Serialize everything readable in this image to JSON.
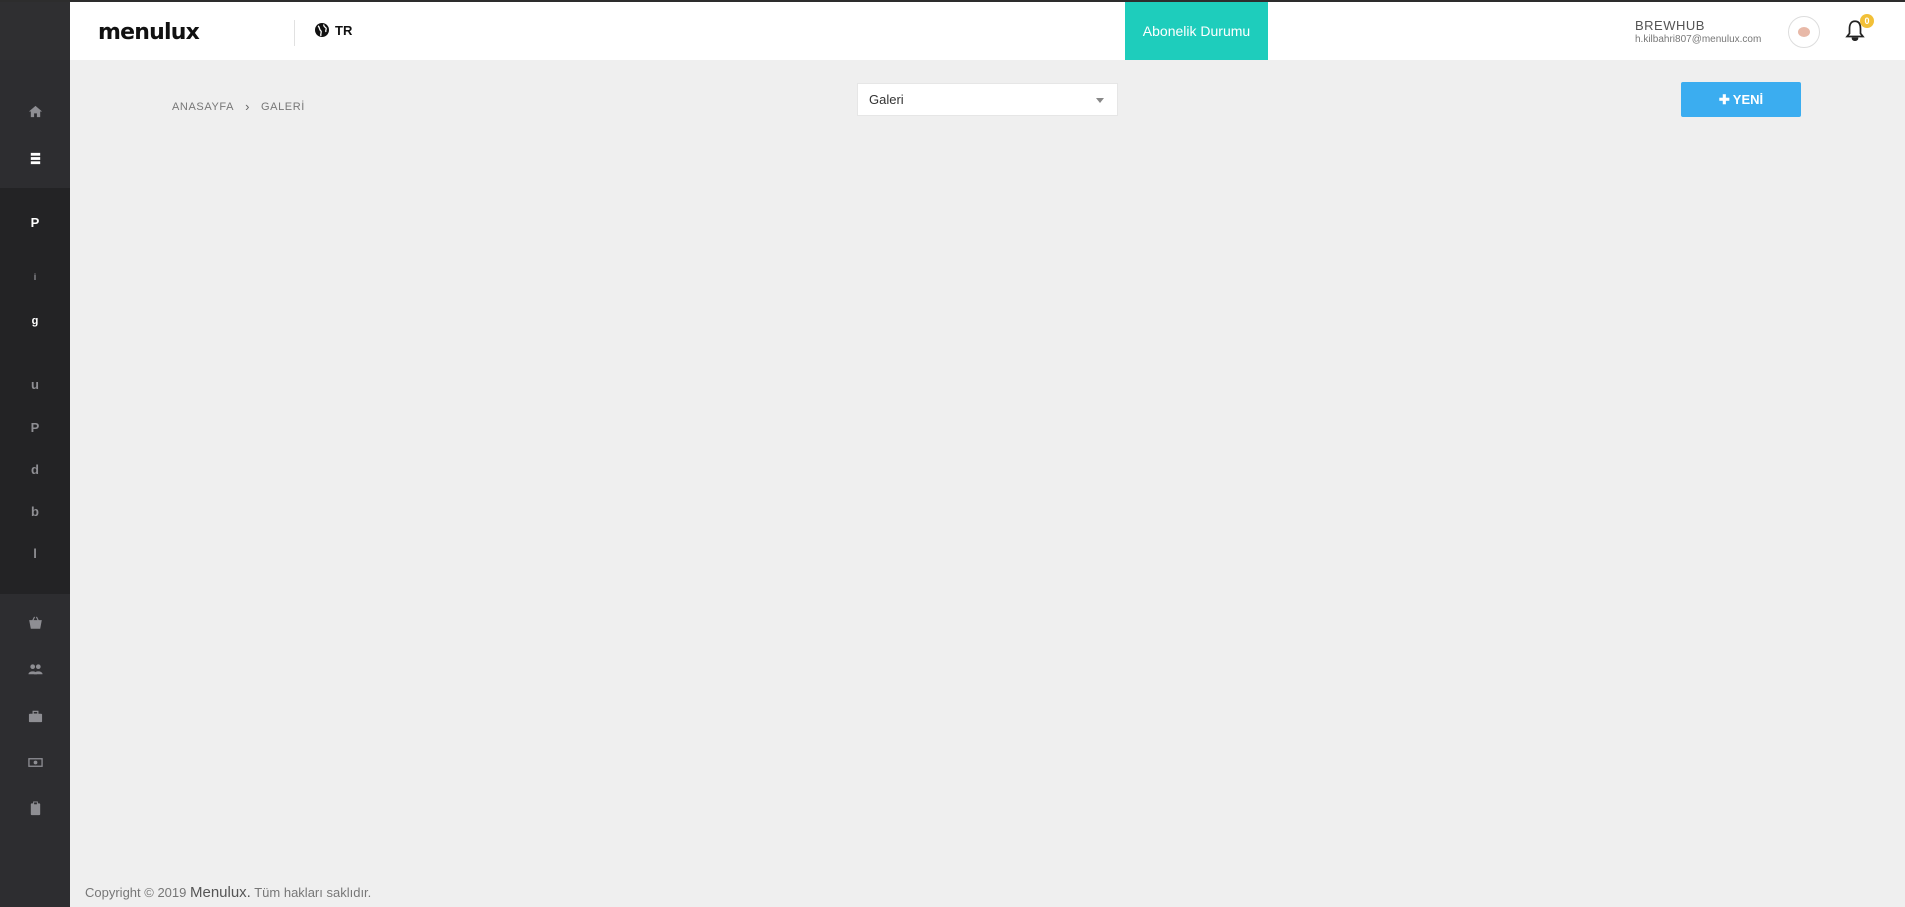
{
  "header": {
    "brand": "menulux",
    "language": "TR",
    "subscription_label": "Abonelik Durumu",
    "user_name": "BREWHUB",
    "user_email": "h.kilbahri807@menulux.com",
    "notification_count": "0"
  },
  "sidebar": {
    "items": [
      {
        "icon": "home-icon"
      },
      {
        "icon": "menu-list-icon"
      },
      {
        "label": "P"
      },
      {
        "label": "i"
      },
      {
        "label": "g"
      },
      {
        "label": "u"
      },
      {
        "label": "P"
      },
      {
        "label": "d"
      },
      {
        "label": "b"
      },
      {
        "label": "l"
      },
      {
        "icon": "basket-icon"
      },
      {
        "icon": "users-icon"
      },
      {
        "icon": "briefcase-icon"
      },
      {
        "icon": "money-icon"
      },
      {
        "icon": "clipboard-icon"
      }
    ]
  },
  "breadcrumb": {
    "home": "ANASAYFA",
    "current": "GALERİ"
  },
  "filter": {
    "selected": "Galeri"
  },
  "actions": {
    "new_label": "YENİ"
  },
  "footer": {
    "prefix": "Copyright © 2019 ",
    "brand": "Menulux.",
    "suffix": " Tüm hakları saklıdır."
  },
  "colors": {
    "sidebar_bg": "#2d2d30",
    "accent_teal": "#1ecdbc",
    "accent_blue": "#3badf0",
    "badge_yellow": "#f2c037"
  }
}
